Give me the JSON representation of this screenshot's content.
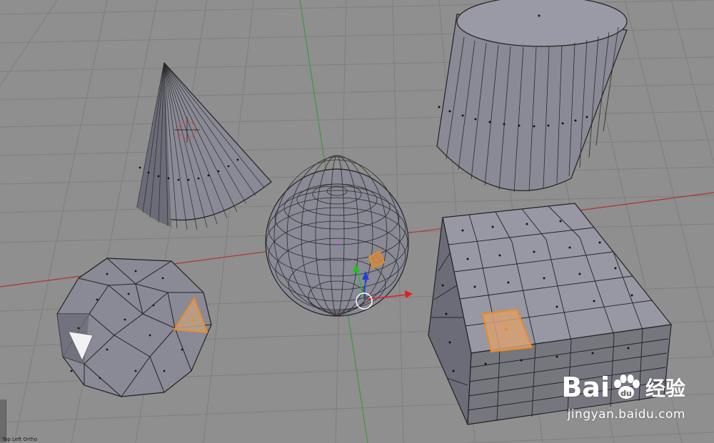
{
  "viewport": {
    "background": "#8f8f8f",
    "grid_color": "#9b9b9b",
    "grid_line_color": "#7f7f7f",
    "axis_x_color": "#b03232",
    "axis_y_color": "#3a9a3a",
    "face_color": "#8a8a96",
    "face_dark": "#6c6c78",
    "edge_color": "#222222",
    "selection_color": "#f08a1e"
  },
  "objects": [
    "cone",
    "uv-sphere",
    "cylinder",
    "icosphere",
    "cube"
  ],
  "gizmo": {
    "x_color": "#e02020",
    "y_color": "#20c020",
    "z_color": "#2040e0"
  },
  "status": {
    "text": "Top Left Ortho"
  },
  "watermark": {
    "brand_left": "Bai",
    "brand_right": "经验",
    "url": "jingyan.baidu.com"
  }
}
